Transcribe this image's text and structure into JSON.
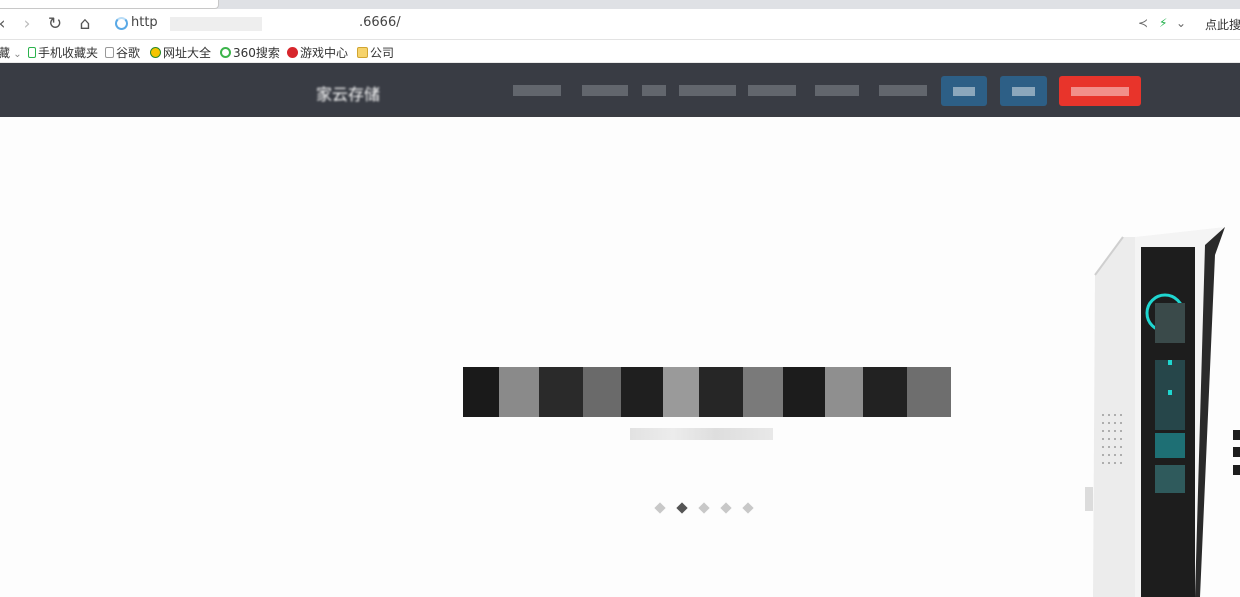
{
  "browser": {
    "tab_title": "",
    "address": {
      "prefix": "http",
      "suffix": ".6666/"
    },
    "search_hint": "点此搜"
  },
  "bookmarks": [
    {
      "label": "藏",
      "icon": "folder-icon"
    },
    {
      "label": "手机收藏夹",
      "icon": "phone-icon"
    },
    {
      "label": "谷歌",
      "icon": "page-icon"
    },
    {
      "label": "网址大全",
      "icon": "site-icon"
    },
    {
      "label": "360搜索",
      "icon": "search-360-icon"
    },
    {
      "label": "游戏中心",
      "icon": "game-icon"
    },
    {
      "label": "公司",
      "icon": "folder-icon"
    }
  ],
  "site": {
    "logo_mark": "",
    "logo_text": "家云存储",
    "nav_items": [
      "",
      "",
      "",
      "",
      "",
      "",
      ""
    ],
    "buttons": [
      {
        "label": "",
        "color": "#2d5f86"
      },
      {
        "label": "",
        "color": "#2d5f86"
      },
      {
        "label": "",
        "color": "#e8342b"
      }
    ]
  },
  "hero": {
    "title": "",
    "subtitle": "",
    "slides_total": 5,
    "active_slide": 2
  },
  "colors": {
    "header_bg": "#393c44",
    "accent_blue": "#2d5f86",
    "accent_red": "#e8342b",
    "device_led": "#1fd6d0"
  }
}
